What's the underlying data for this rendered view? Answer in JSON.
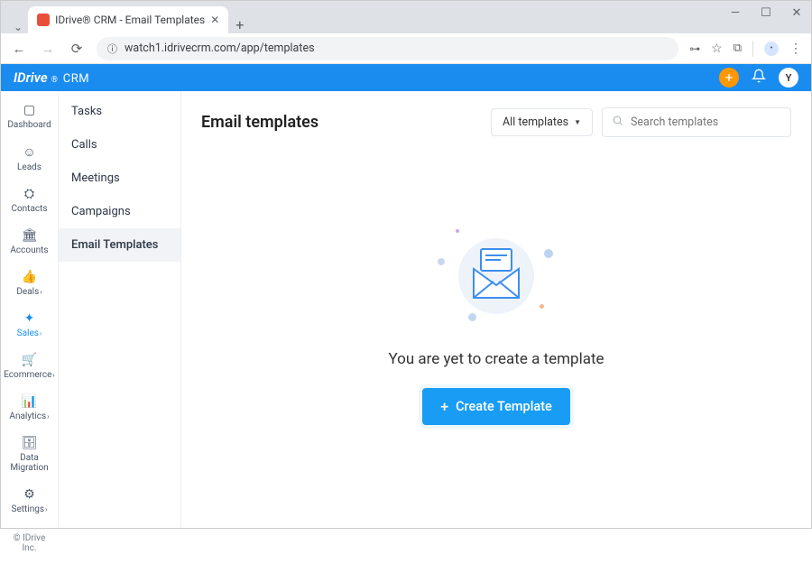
{
  "browser": {
    "tab_title": "IDrive® CRM - Email Templates",
    "url": "watch1.idrivecrm.com/app/templates"
  },
  "window_controls": {
    "min": "—",
    "max": "☐",
    "close": "✕"
  },
  "header": {
    "brand_main": "IDrive",
    "brand_reg": "®",
    "brand_sub": "CRM",
    "avatar_initial": "Y"
  },
  "nav1": {
    "items": [
      {
        "label": "Dashboard",
        "submenu": false
      },
      {
        "label": "Leads",
        "submenu": false
      },
      {
        "label": "Contacts",
        "submenu": false
      },
      {
        "label": "Accounts",
        "submenu": false
      },
      {
        "label": "Deals",
        "submenu": true
      },
      {
        "label": "Sales",
        "submenu": true
      },
      {
        "label": "Ecommerce",
        "submenu": true
      },
      {
        "label": "Analytics",
        "submenu": true
      },
      {
        "label": "Data Migration",
        "submenu": false
      },
      {
        "label": "Settings",
        "submenu": true
      }
    ],
    "active_index": 5,
    "footer": "© IDrive Inc."
  },
  "nav2": {
    "items": [
      "Tasks",
      "Calls",
      "Meetings",
      "Campaigns",
      "Email Templates"
    ],
    "active_index": 4
  },
  "content": {
    "title": "Email templates",
    "filter_label": "All templates",
    "search_placeholder": "Search templates",
    "empty_message": "You are yet to create a template",
    "create_button": "Create Template"
  }
}
